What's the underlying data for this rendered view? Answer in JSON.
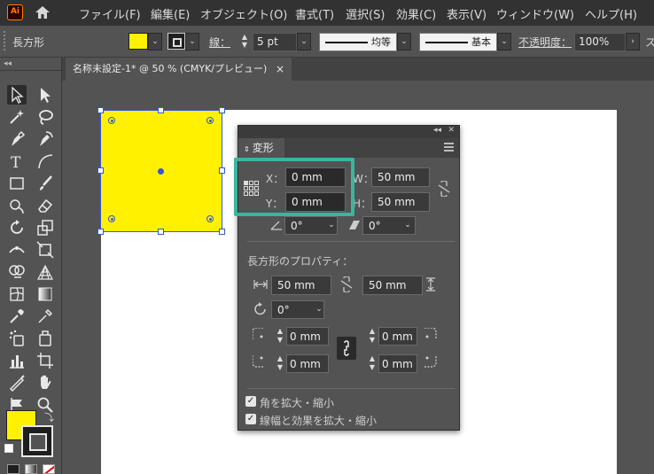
{
  "app": {
    "logo_text": "Ai"
  },
  "menubar": {
    "items": [
      "ファイル(F)",
      "編集(E)",
      "オブジェクト(O)",
      "書式(T)",
      "選択(S)",
      "効果(C)",
      "表示(V)",
      "ウィンドウ(W)",
      "ヘルプ(H)"
    ]
  },
  "controlbar": {
    "object_type": "長方形",
    "stroke_label": "線：",
    "stroke_weight": "5 pt",
    "profile_label": "均等",
    "brush_label": "基本",
    "opacity_label": "不透明度：",
    "opacity_value": "100%",
    "overflow_label": "ス"
  },
  "tab": {
    "title": "名称未設定-1* @ 50 % (CMYK/プレビュー)",
    "close": "×"
  },
  "transform_panel": {
    "title": "変形",
    "x_label": "X：",
    "x_value": "0 mm",
    "y_label": "Y：",
    "y_value": "0 mm",
    "w_label": "W：",
    "w_value": "50 mm",
    "h_label": "H：",
    "h_value": "50 mm",
    "angle_value": "0°",
    "shear_value": "0°",
    "rect_props_title": "長方形のプロパティ：",
    "rect_width": "50 mm",
    "rect_height": "50 mm",
    "rect_angle": "0°",
    "corner_tl": "0 mm",
    "corner_tr": "0 mm",
    "corner_bl": "0 mm",
    "corner_br": "0 mm",
    "scale_corners_label": "角を拡大・縮小",
    "scale_strokes_label": "線幅と効果を拡大・縮小"
  },
  "colors": {
    "fill": "#fff100",
    "selection": "#3656d6",
    "highlight": "#3ab5a0"
  }
}
